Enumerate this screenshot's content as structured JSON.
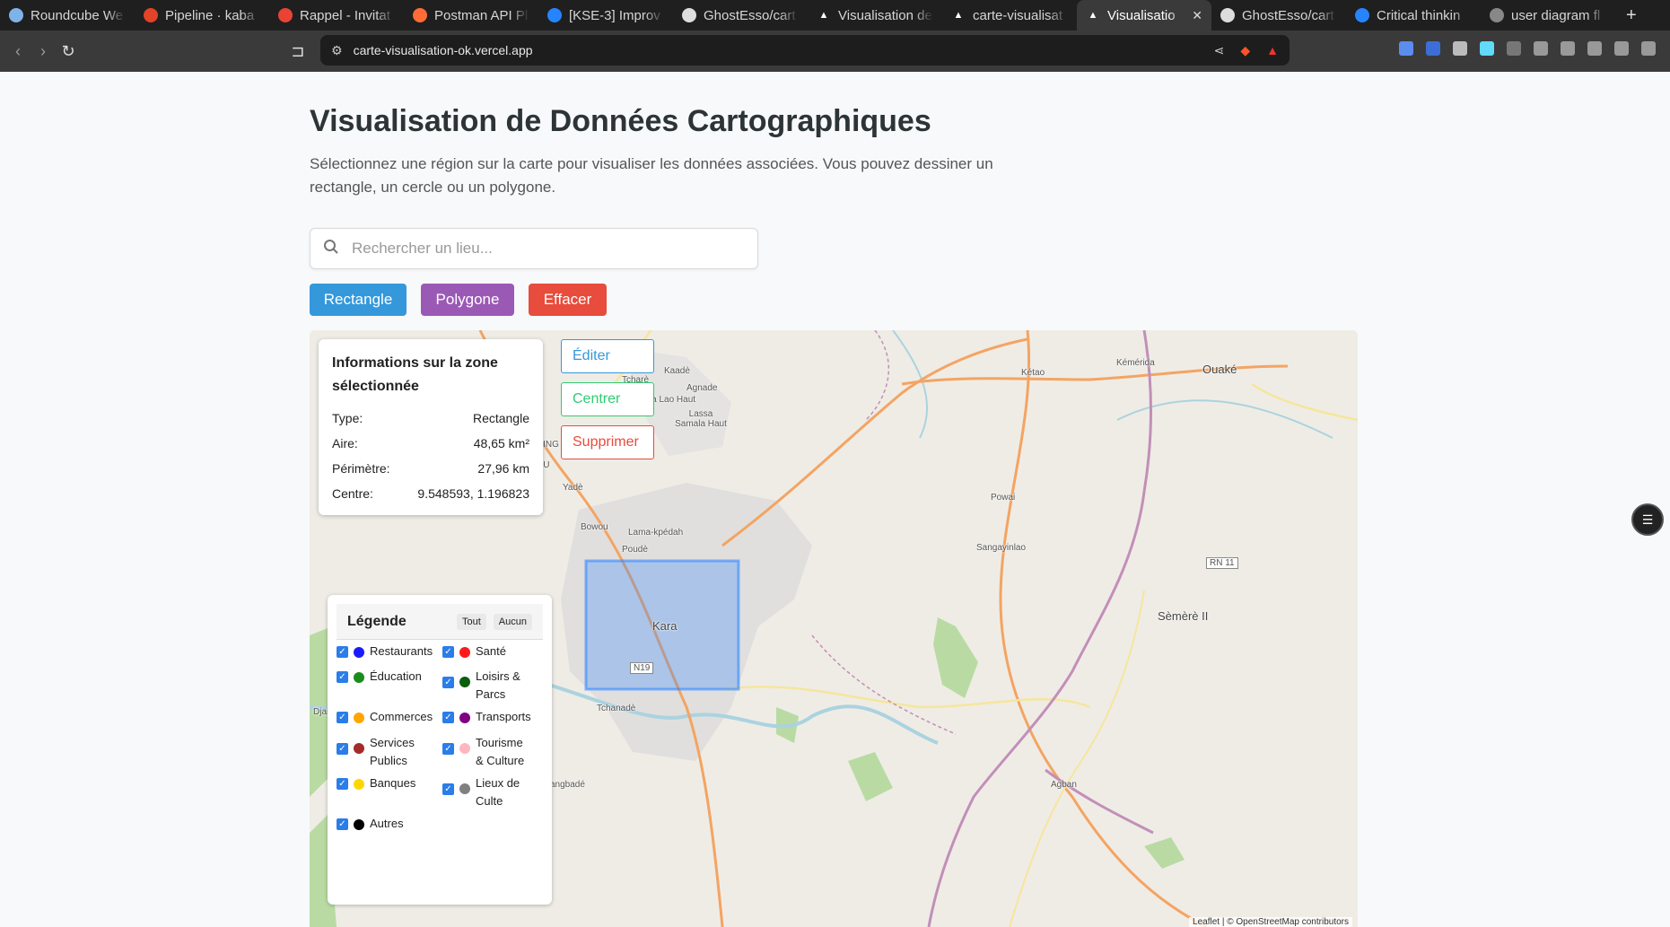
{
  "browser": {
    "tabs": [
      {
        "label": "Roundcube We",
        "color": "#7fb3e8"
      },
      {
        "label": "Pipeline · kaba",
        "color": "#e24329"
      },
      {
        "label": "Rappel - Invitat",
        "color": "#ea4335"
      },
      {
        "label": "Postman API Pl",
        "color": "#ff6c37"
      },
      {
        "label": "[KSE-3] Improv",
        "color": "#2684ff"
      },
      {
        "label": "GhostEsso/cart",
        "color": "#dddddd"
      },
      {
        "label": "Visualisation de",
        "color": "#dddddd"
      },
      {
        "label": "carte-visualisat",
        "color": "#dddddd"
      },
      {
        "label": "Visualisatio",
        "color": "#dddddd"
      },
      {
        "label": "GhostEsso/cart",
        "color": "#dddddd"
      },
      {
        "label": "Critical thinkin",
        "color": "#2684ff"
      },
      {
        "label": "user diagram fl",
        "color": "#dddddd"
      }
    ],
    "url": "carte-visualisation-ok.vercel.app"
  },
  "page": {
    "title": "Visualisation de Données Cartographiques",
    "description": "Sélectionnez une région sur la carte pour visualiser les données associées. Vous pouvez dessiner un rectangle, un cercle ou un polygone.",
    "search_placeholder": "Rechercher un lieu...",
    "buttons": {
      "rectangle": "Rectangle",
      "polygon": "Polygone",
      "clear": "Effacer"
    }
  },
  "info": {
    "title": "Informations sur la zone sélectionnée",
    "rows": [
      {
        "label": "Type:",
        "value": "Rectangle"
      },
      {
        "label": "Aire:",
        "value": "48,65 km²"
      },
      {
        "label": "Périmètre:",
        "value": "27,96 km"
      },
      {
        "label": "Centre:",
        "value": "9.548593, 1.196823"
      }
    ]
  },
  "actions": {
    "edit": "Éditer",
    "center": "Centrer",
    "delete": "Supprimer"
  },
  "legend": {
    "title": "Légende",
    "all": "Tout",
    "none": "Aucun",
    "items": [
      {
        "label": "Restaurants",
        "color": "#1a1aff"
      },
      {
        "label": "Santé",
        "color": "#ff1a1a"
      },
      {
        "label": "Éducation",
        "color": "#1a8c1a"
      },
      {
        "label": "Loisirs & Parcs",
        "color": "#0b5e0b"
      },
      {
        "label": "Commerces",
        "color": "#ffa500"
      },
      {
        "label": "Transports",
        "color": "#800080"
      },
      {
        "label": "Services Publics",
        "color": "#a52a2a"
      },
      {
        "label": "Tourisme & Culture",
        "color": "#ffb6c1"
      },
      {
        "label": "Banques",
        "color": "#ffd700"
      },
      {
        "label": "Lieux de Culte",
        "color": "#808080"
      },
      {
        "label": "Autres",
        "color": "#000000"
      }
    ]
  },
  "map": {
    "places": [
      "Kaadè",
      "Tcharè",
      "Agnade",
      "Lassa Lao Haut",
      "Lassa Samala Haut",
      "KIGBELING",
      "FATOU",
      "Yadè",
      "Bowou",
      "Lama-kpédah",
      "Poudè",
      "Kara",
      "N19",
      "Tchanadè",
      "Kétao",
      "Kémérida",
      "Ouaké",
      "Powai",
      "Sangayinlao",
      "RN 11",
      "Sèmèrè II",
      "Agban",
      "Djan",
      "angbadé"
    ],
    "attribution": "Leaflet | © OpenStreetMap contributors"
  }
}
